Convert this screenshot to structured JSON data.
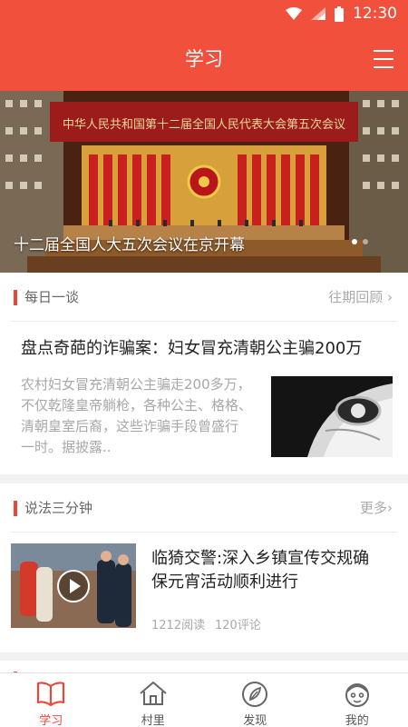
{
  "status": {
    "time": "12:30"
  },
  "header": {
    "title": "学习"
  },
  "banner": {
    "caption": "十二届全国人大五次会议在京开幕",
    "slide_text": "中华人民共和国第十二届全国人民代表大会第五次会议"
  },
  "daily": {
    "section_title": "每日一谈",
    "more_label": "往期回顾 ›",
    "article": {
      "title": "盘点奇葩的诈骗案：妇女冒充清朝公主骗200万",
      "summary_lines": [
        "农村妇女冒充清朝公主骗走200多万，",
        "不仅乾隆皇帝躺枪，各种公主、格格、",
        "清朝皇室后裔，这些诈骗手段曾盛行",
        "一时。据披露.."
      ]
    }
  },
  "law": {
    "section_title": "说法三分钟",
    "more_label": "更多›",
    "article": {
      "title_lines": [
        "临猗交警:深入乡镇宣传交规确",
        "保元宵活动顺利进行"
      ],
      "reads": "1212阅读",
      "comments": "120评论"
    }
  },
  "tabs": [
    {
      "label": "学习",
      "icon": "book-icon"
    },
    {
      "label": "村里",
      "icon": "house-icon"
    },
    {
      "label": "发现",
      "icon": "compass-leaf-icon"
    },
    {
      "label": "我的",
      "icon": "face-icon"
    }
  ],
  "colors": {
    "accent": "#f0503c",
    "active_tab": "#e8483a"
  }
}
